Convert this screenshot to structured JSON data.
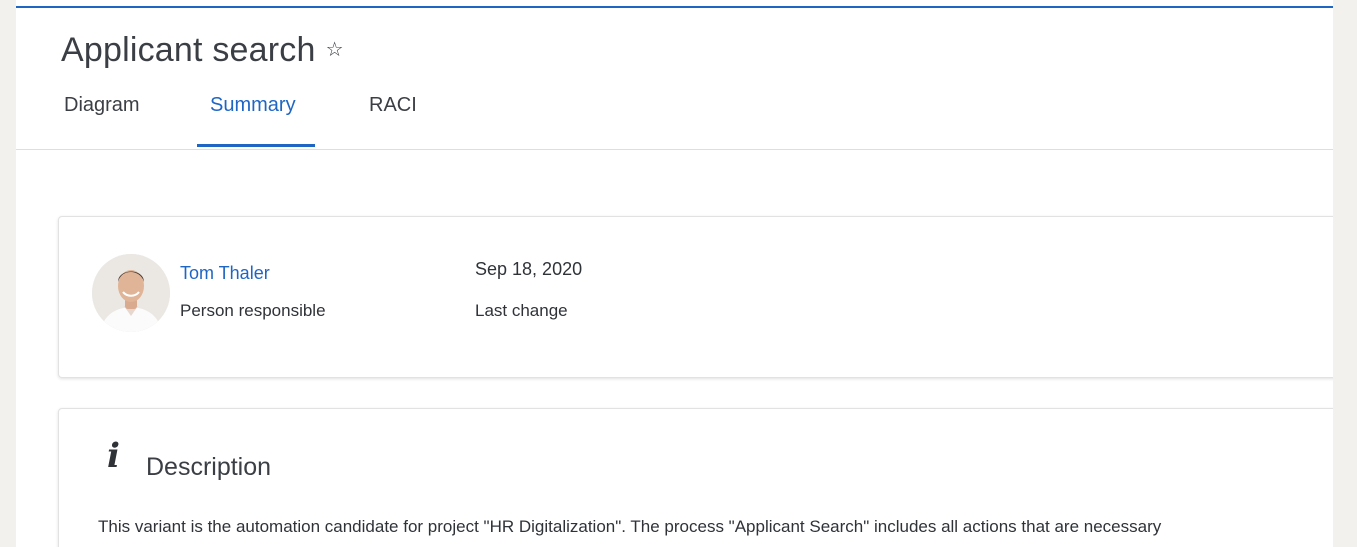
{
  "header": {
    "title": "Applicant search",
    "star_icon": "☆"
  },
  "tabs": [
    {
      "label": "Diagram",
      "active": false
    },
    {
      "label": "Summary",
      "active": true
    },
    {
      "label": "RACI",
      "active": false
    }
  ],
  "person": {
    "name": "Tom Thaler",
    "role": "Person responsible",
    "avatar_icon": "avatar-photo"
  },
  "last_change": {
    "date": "Sep 18, 2020",
    "label": "Last change"
  },
  "description": {
    "icon": "i",
    "heading": "Description",
    "text": "This variant is the automation candidate for project \"HR Digitalization\". The process \"Applicant Search\" includes all actions that are necessary"
  },
  "colors": {
    "accent": "#1f66c4",
    "background": "#f2f1ed",
    "text": "#2f3338"
  }
}
